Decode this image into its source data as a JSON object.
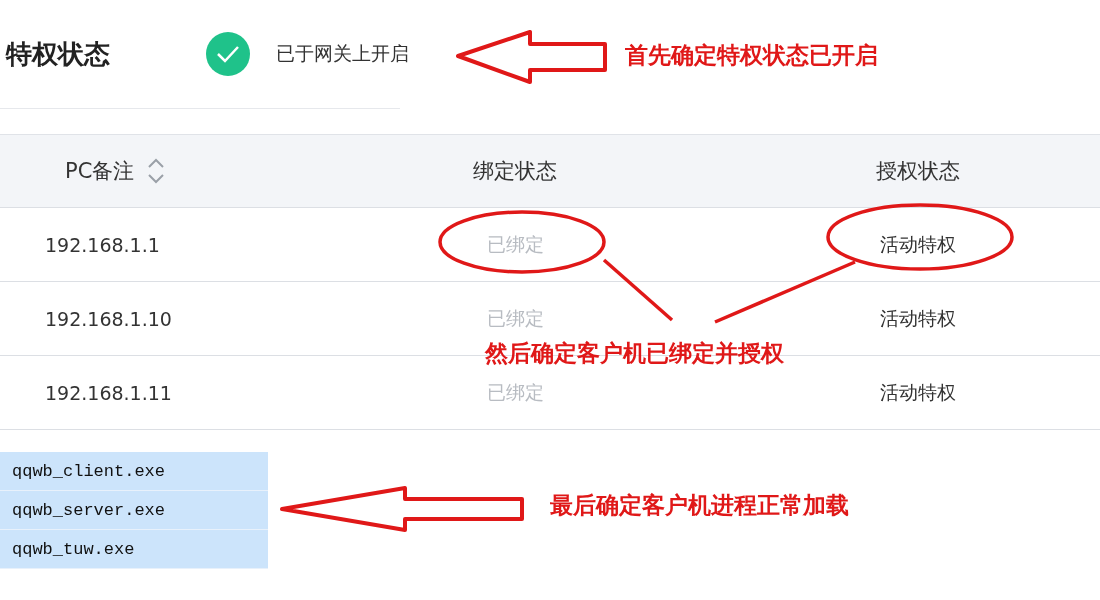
{
  "section": {
    "title": "特权状态",
    "status": {
      "enabled": true,
      "text": "已于网关上开启"
    }
  },
  "table": {
    "columns": [
      {
        "label": "PC备注",
        "sortable": true
      },
      {
        "label": "绑定状态"
      },
      {
        "label": "授权状态"
      }
    ],
    "rows": [
      {
        "pc": "192.168.1.1",
        "binding": "已绑定",
        "auth": "活动特权"
      },
      {
        "pc": "192.168.1.10",
        "binding": "已绑定",
        "auth": "活动特权"
      },
      {
        "pc": "192.168.1.11",
        "binding": "已绑定",
        "auth": "活动特权"
      }
    ]
  },
  "processes": [
    "qqwb_client.exe",
    "qqwb_server.exe",
    "qqwb_tuw.exe"
  ],
  "annotations": [
    {
      "text": "首先确定特权状态已开启"
    },
    {
      "text": "然后确定客户机已绑定并授权"
    },
    {
      "text": "最后确定客户机进程正常加载"
    }
  ]
}
